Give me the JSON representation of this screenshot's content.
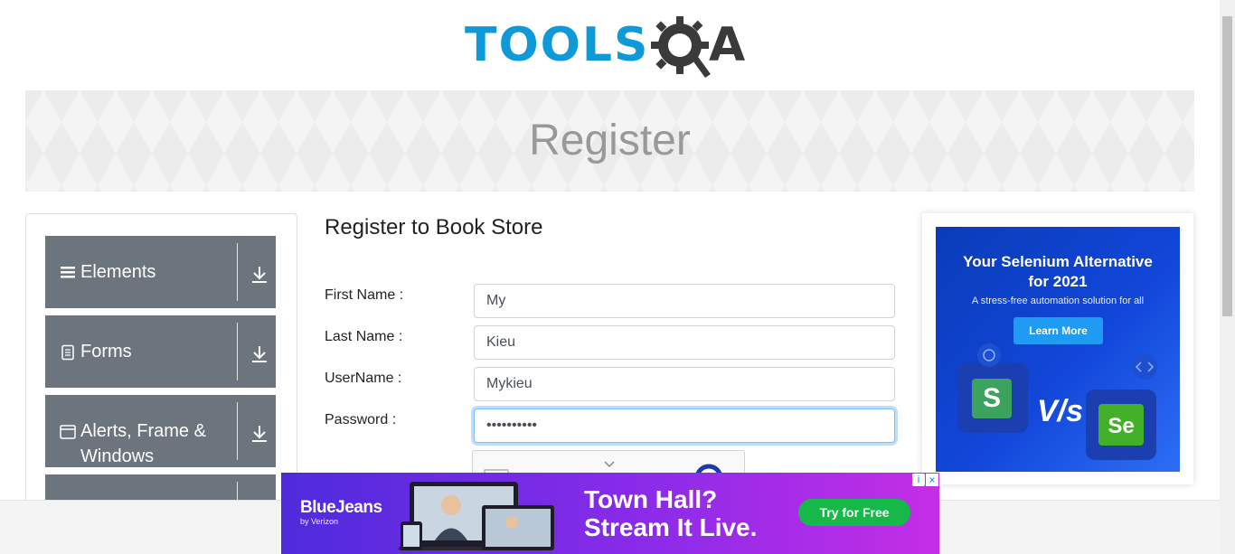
{
  "logo": {
    "text_tools": "TOOLS",
    "text_a": "A"
  },
  "banner": {
    "title": "Register"
  },
  "sidebar": {
    "groups": [
      {
        "label": "Elements",
        "icon": "hamburger-icon"
      },
      {
        "label": "Forms",
        "icon": "document-icon"
      },
      {
        "label": "Alerts, Frame &",
        "label2": "Windows",
        "icon": "window-icon"
      },
      {
        "label": "",
        "icon": ""
      }
    ]
  },
  "form": {
    "title": "Register to Book Store",
    "first_name_label": "First Name :",
    "first_name_value": "My",
    "last_name_label": "Last Name :",
    "last_name_value": "Kieu",
    "username_label": "UserName :",
    "username_value": "Mykieu",
    "password_label": "Password :",
    "password_value": "••••••••••"
  },
  "right_ad": {
    "headline_line1": "Your Selenium Alternative",
    "headline_line2": "for 2021",
    "sub": "A stress-free automation solution for all",
    "cta": "Learn More",
    "vs_text": "V/s",
    "tile_left": "S",
    "tile_right": "Se"
  },
  "bottom_ad": {
    "brand": "BlueJeans",
    "brand_sub": "by Verizon",
    "headline1": "Town Hall?",
    "headline2": "Stream It Live.",
    "cta": "Try for Free",
    "adchoice": "i",
    "close": "×"
  },
  "colors": {
    "brand_blue": "#0e9ad8",
    "sidebar_gray": "#6c757d",
    "focus_border": "#80bdff"
  }
}
